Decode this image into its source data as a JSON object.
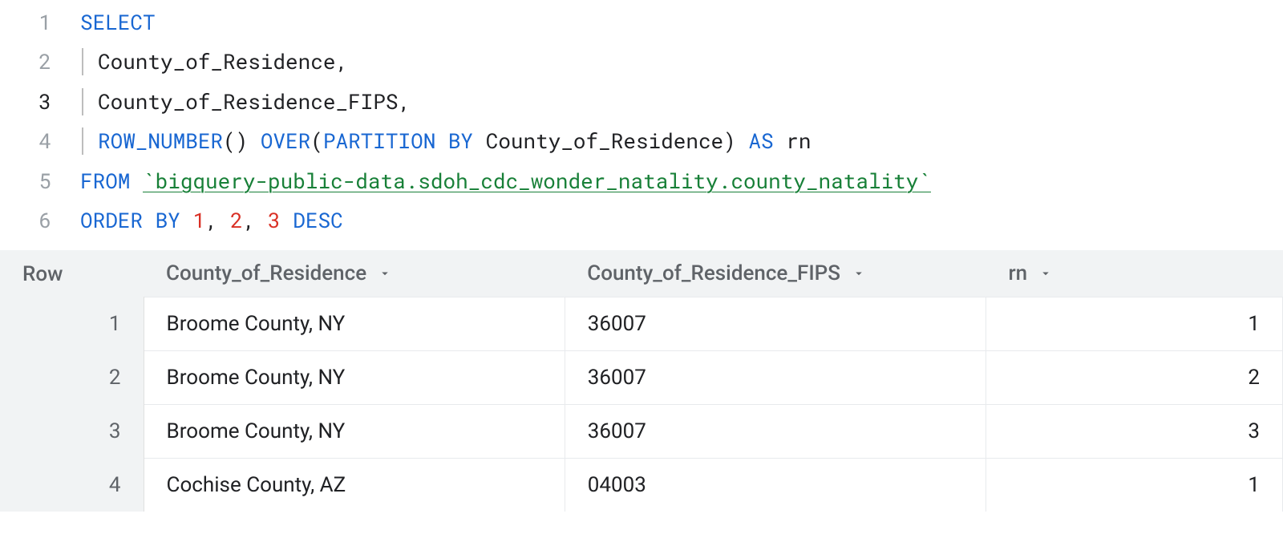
{
  "editor": {
    "lines": [
      {
        "n": "1",
        "current": false,
        "tokens": [
          {
            "cls": "kw",
            "t": "SELECT"
          }
        ]
      },
      {
        "n": "2",
        "current": false,
        "indent": true,
        "tokens": [
          {
            "cls": "id",
            "t": "County_of_Residence"
          },
          {
            "cls": "pn",
            "t": ","
          }
        ]
      },
      {
        "n": "3",
        "current": true,
        "indent": true,
        "tokens": [
          {
            "cls": "id",
            "t": "County_of_Residence_FIPS"
          },
          {
            "cls": "pn",
            "t": ","
          }
        ]
      },
      {
        "n": "4",
        "current": false,
        "indent": true,
        "tokens": [
          {
            "cls": "fn",
            "t": "ROW_NUMBER"
          },
          {
            "cls": "pn",
            "t": "() "
          },
          {
            "cls": "kw",
            "t": "OVER"
          },
          {
            "cls": "pn",
            "t": "("
          },
          {
            "cls": "kw",
            "t": "PARTITION BY"
          },
          {
            "cls": "id",
            "t": " County_of_Residence"
          },
          {
            "cls": "pn",
            "t": ") "
          },
          {
            "cls": "kw",
            "t": "AS"
          },
          {
            "cls": "id",
            "t": " rn"
          }
        ]
      },
      {
        "n": "5",
        "current": false,
        "tokens": [
          {
            "cls": "kw",
            "t": "FROM "
          },
          {
            "cls": "str",
            "t": "`bigquery-public-data.sdoh_cdc_wonder_natality.county_natality`"
          }
        ]
      },
      {
        "n": "6",
        "current": false,
        "tokens": [
          {
            "cls": "kw",
            "t": "ORDER BY "
          },
          {
            "cls": "num",
            "t": "1"
          },
          {
            "cls": "pn",
            "t": ", "
          },
          {
            "cls": "num",
            "t": "2"
          },
          {
            "cls": "pn",
            "t": ", "
          },
          {
            "cls": "num",
            "t": "3"
          },
          {
            "cls": "kw",
            "t": " DESC"
          }
        ]
      }
    ]
  },
  "results": {
    "columns": {
      "row": "Row",
      "c1": "County_of_Residence",
      "c2": "County_of_Residence_FIPS",
      "c3": "rn"
    },
    "rows": [
      {
        "n": "1",
        "c1": "Broome County, NY",
        "c2": "36007",
        "c3": "1"
      },
      {
        "n": "2",
        "c1": "Broome County, NY",
        "c2": "36007",
        "c3": "2"
      },
      {
        "n": "3",
        "c1": "Broome County, NY",
        "c2": "36007",
        "c3": "3"
      },
      {
        "n": "4",
        "c1": "Cochise County, AZ",
        "c2": "04003",
        "c3": "1"
      }
    ]
  }
}
